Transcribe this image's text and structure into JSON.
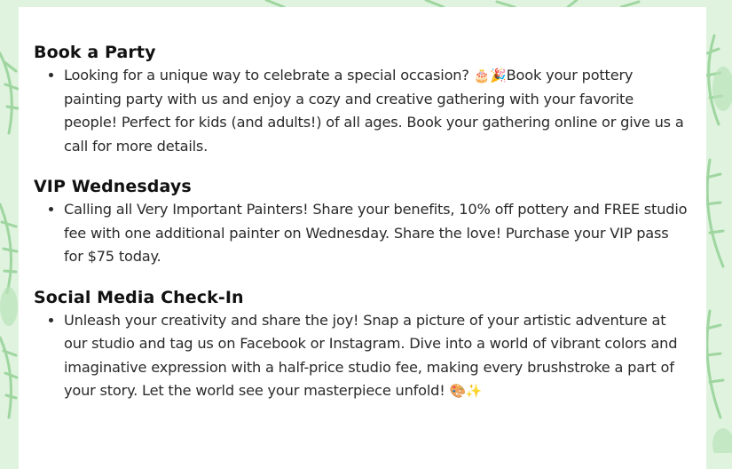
{
  "sections": [
    {
      "title": "Book a Party",
      "text_before_emoji": "Looking for a unique way to celebrate a special occasion? ",
      "emoji": "🎂🎉",
      "text_after_emoji": "Book your pottery painting party with us and enjoy a cozy and creative gathering with your favorite people! Perfect for kids (and adults!) of all ages. Book your gathering online or give us a call for more details."
    },
    {
      "title": "VIP Wednesdays",
      "text": "Calling all Very Important Painters! Share your benefits, 10% off pottery and FREE studio fee with one additional painter on Wednesday. Share the love! Purchase your VIP pass for $75 today."
    },
    {
      "title": "Social Media Check-In",
      "text": "Unleash your creativity and share the joy!  Snap a picture of your artistic adventure at our studio and tag us on Facebook or Instagram. Dive into a world of vibrant colors and imaginative expression with a half-price studio fee, making every brushstroke a part of your story. Let the world see your masterpiece unfold! ",
      "emoji": "🎨✨"
    }
  ],
  "colors": {
    "background": "#dff3df",
    "leaf": "#9fd6a0",
    "card": "#ffffff",
    "text": "#2a2a2a",
    "heading": "#111111"
  }
}
